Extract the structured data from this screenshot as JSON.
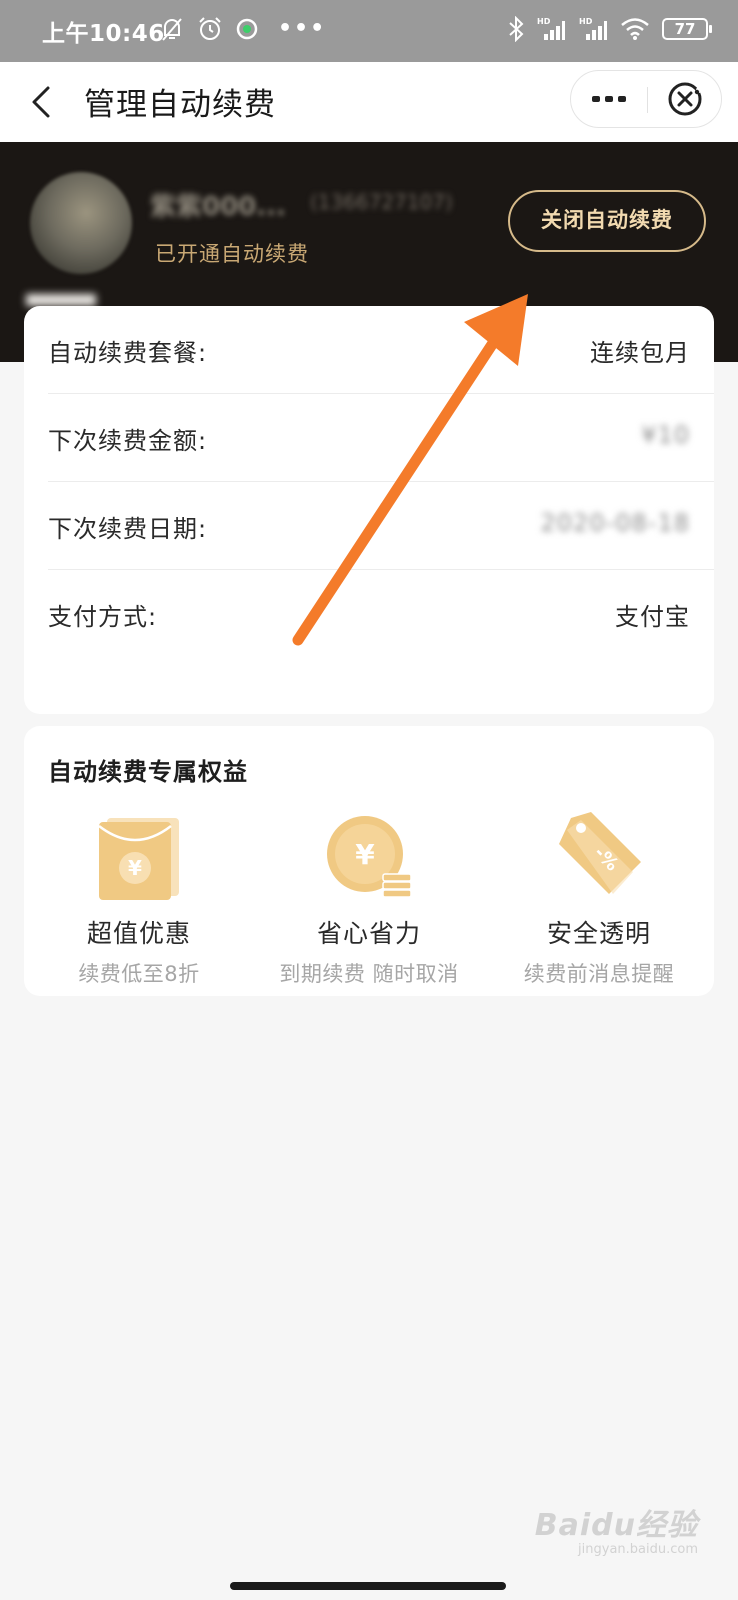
{
  "status_bar": {
    "time": "上午10:46",
    "more_dots": "•••",
    "battery": "77"
  },
  "nav": {
    "title": "管理自动续费"
  },
  "header": {
    "username": "紫紫000...",
    "phone": "(1366727107)",
    "status": "已开通自动续费",
    "close_button": "关闭自动续费"
  },
  "details": {
    "rows": [
      {
        "label": "自动续费套餐:",
        "value": "连续包月"
      },
      {
        "label": "下次续费金额:",
        "value": "¥10"
      },
      {
        "label": "下次续费日期:",
        "value": "2020-08-18"
      },
      {
        "label": "支付方式:",
        "value": "支付宝"
      }
    ]
  },
  "benefits": {
    "title": "自动续费专属权益",
    "items": [
      {
        "title": "超值优惠",
        "subtitle": "续费低至8折",
        "icon": "red-envelope-icon"
      },
      {
        "title": "省心省力",
        "subtitle": "到期续费 随时取消",
        "icon": "coin-icon"
      },
      {
        "title": "安全透明",
        "subtitle": "续费前消息提醒",
        "icon": "discount-tag-icon"
      }
    ]
  },
  "watermark": {
    "brand": "Baidu经验",
    "url": "jingyan.baidu.com"
  },
  "colors": {
    "header_bg": "#1b1714",
    "gold": "#d6ba8a",
    "arrow": "#f47b2a",
    "icon_gold": "#f0c983"
  }
}
